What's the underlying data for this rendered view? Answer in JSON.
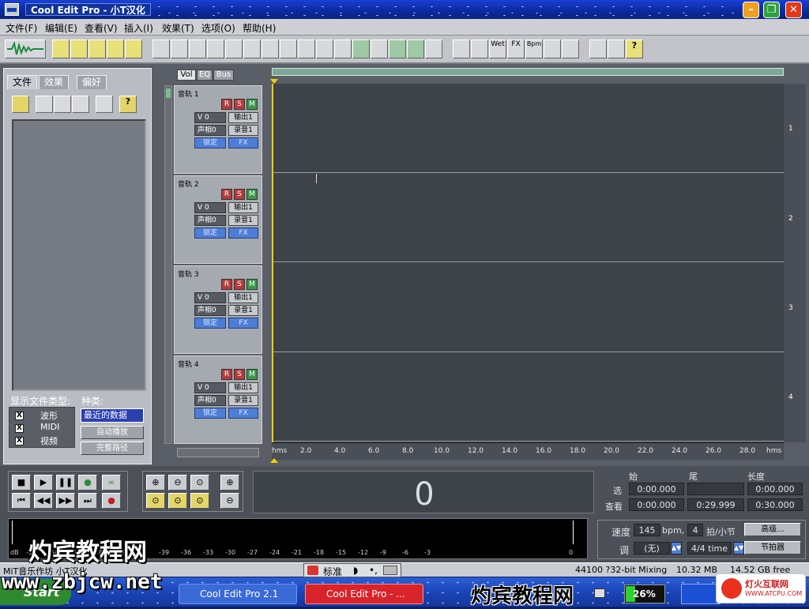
{
  "window": {
    "title": "Cool Edit Pro  - 小T汉化",
    "colors": {
      "titlebar": "#0a2a9e",
      "minimize": "#f0a020",
      "maximize": "#2fa040",
      "close": "#e03a1a"
    }
  },
  "menu": [
    "文件(F)",
    "编辑(E)",
    "查看(V)",
    "插入(I)",
    "效果(T)",
    "选项(O)",
    "帮助(H)"
  ],
  "toolbar": {
    "labels": [
      "Wet",
      "FX",
      "Bpm"
    ]
  },
  "organizer": {
    "tabs": [
      "文件",
      "效果",
      "偏好"
    ],
    "filetypes_label": "显示文件类型:",
    "filetypes": [
      {
        "label": "波形",
        "checked": "X"
      },
      {
        "label": "MIDI",
        "checked": "X"
      },
      {
        "label": "视频",
        "checked": "X"
      }
    ],
    "sort_label": "种类:",
    "sort_value": "最近的数据",
    "autoplay": "自动播放",
    "fullpath": "完整路径"
  },
  "track_tabs": [
    "Vol",
    "EQ",
    "Bus"
  ],
  "tracks": [
    {
      "name": "音轨 1",
      "vol": "V 0",
      "pan": "声相0",
      "out": "输出1",
      "rec": "录音1",
      "lock": "锁定",
      "fx": "FX",
      "lane_no": "1"
    },
    {
      "name": "音轨 2",
      "vol": "V 0",
      "pan": "声相0",
      "out": "输出1",
      "rec": "录音1",
      "lock": "锁定",
      "fx": "FX",
      "lane_no": "2"
    },
    {
      "name": "音轨 3",
      "vol": "V 0",
      "pan": "声相0",
      "out": "输出1",
      "rec": "录音1",
      "lock": "锁定",
      "fx": "FX",
      "lane_no": "3"
    },
    {
      "name": "音轨 4",
      "vol": "V 0",
      "pan": "声相0",
      "out": "输出1",
      "rec": "录音1",
      "lock": "锁定",
      "fx": "FX",
      "lane_no": "4"
    }
  ],
  "rsm": [
    "R",
    "S",
    "M"
  ],
  "ruler": [
    "hms",
    "2.0",
    "4.0",
    "6.0",
    "8.0",
    "10.0",
    "12.0",
    "14.0",
    "16.0",
    "18.0",
    "20.0",
    "22.0",
    "24.0",
    "26.0",
    "28.0",
    "hms"
  ],
  "time_display": "0",
  "selection": {
    "headers": [
      "始",
      "尾",
      "长度"
    ],
    "rows": [
      {
        "label": "选",
        "begin": "0:00.000",
        "end": "",
        "length": "0:00.000"
      },
      {
        "label": "查看",
        "begin": "0:00.000",
        "end": "0:29.999",
        "length": "0:30.000"
      }
    ]
  },
  "tempo": {
    "label": "速度",
    "bpm": "145",
    "bpm_unit": "bpm,",
    "beats": "4",
    "beats_unit": "拍/小节",
    "advanced": "高级...",
    "key_label": "调",
    "key_value": "(无)",
    "time_sig": "4/4 time",
    "metronome": "节拍器"
  },
  "meter_scale": [
    "dB",
    "-57",
    "-54",
    "-51",
    "-48",
    "-45",
    "-42",
    "-39",
    "-36",
    "-33",
    "-30",
    "-27",
    "-24",
    "-21",
    "-18",
    "-15",
    "-12",
    "-9",
    "-6",
    "-3",
    "0"
  ],
  "status": {
    "left": "MiT音乐作坊 小T汉化",
    "ime_mode": "标准",
    "format": "44100 ?32-bit Mixing",
    "size": "10.32 MB",
    "free": "14.52 GB free"
  },
  "taskbar": {
    "start": "Start",
    "tasks": [
      "Cool Edit Pro 2.1",
      "Cool Edit Pro  - ..."
    ],
    "battery": "26%"
  },
  "watermarks": {
    "top": "灼宾教程网",
    "url": "www.zbjcw.net",
    "bottom": "灼宾教程网",
    "badge_cn": "灯火互联网",
    "badge_url": "WWW.ATCPU.COM"
  }
}
